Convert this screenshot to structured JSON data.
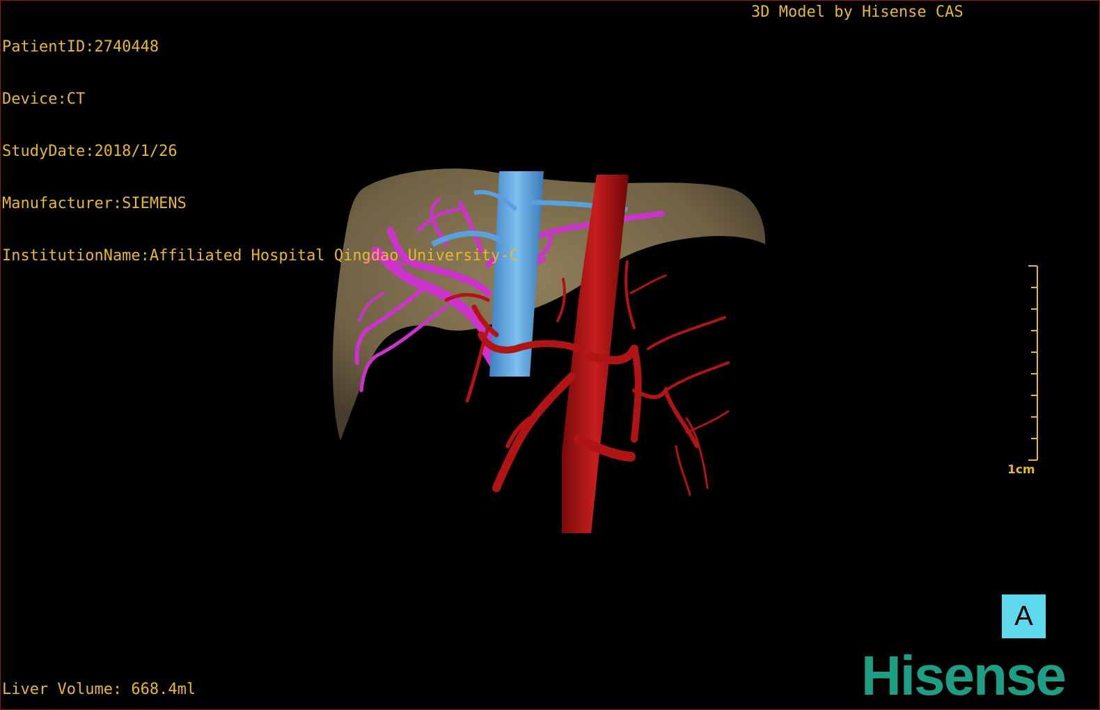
{
  "metadata": {
    "patient_id": "PatientID:2740448",
    "device": "Device:CT",
    "study_date": "StudyDate:2018/1/26",
    "manufacturer": "Manufacturer:SIEMENS",
    "institution": "InstitutionName:Affiliated Hospital Qingdao University-C"
  },
  "model_credit": "3D Model by Hisense CAS",
  "liver_volume": "Liver Volume: 668.4ml",
  "scale_bar": {
    "label": "1cm",
    "tick_count": 10
  },
  "orientation_marker": "A",
  "brand": "Hisense",
  "colors": {
    "overlay_text": "#e8b830",
    "liver": "#8a7a58",
    "hepatic_vein": "#cc33cc",
    "vena_cava": "#5aa0dc",
    "artery": "#b01414",
    "orientation_cube": "#5fd8ec",
    "brand": "#1f9e86"
  }
}
